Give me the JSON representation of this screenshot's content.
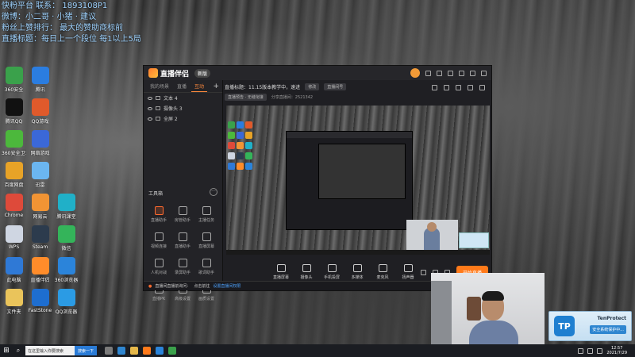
{
  "overlay_lines": [
    "快粉平台 联系： 1893108P1",
    "微博：小二哥 · 小猪 · 建议",
    "粉丝上赞排行：  最大的赞助商标前",
    "直播标题：每日上一个段位   每1以上5局"
  ],
  "desktop_icons": [
    {
      "label": "360安全",
      "icon": "shield-icon",
      "color": "#3aa14b"
    },
    {
      "label": "腾讯",
      "icon": "penguin-icon",
      "color": "#2b7de0"
    },
    {
      "label": "",
      "icon": "blank",
      "color": "transparent"
    },
    {
      "label": "腾讯QQ",
      "icon": "qq-icon",
      "color": "#111111"
    },
    {
      "label": "QQ游戏",
      "icon": "game-icon",
      "color": "#e05a2b"
    },
    {
      "label": "",
      "icon": "blank",
      "color": "transparent"
    },
    {
      "label": "360安全卫士",
      "icon": "plus-icon",
      "color": "#4cb83c"
    },
    {
      "label": "网络游戏",
      "icon": "controller-icon",
      "color": "#3b68d8"
    },
    {
      "label": "",
      "icon": "blank",
      "color": "transparent"
    },
    {
      "label": "百度网盘",
      "icon": "cloud-icon",
      "color": "#e8a327"
    },
    {
      "label": "迅雷",
      "icon": "bolt-icon",
      "color": "#6bb6f0"
    },
    {
      "label": "",
      "icon": "blank",
      "color": "transparent"
    },
    {
      "label": "Chrome",
      "icon": "browser-icon",
      "color": "#de4a3a"
    },
    {
      "label": "网易云",
      "icon": "music-icon",
      "color": "#f19434"
    },
    {
      "label": "腾讯课堂",
      "icon": "app-icon",
      "color": "#20b0c8"
    },
    {
      "label": "WPS",
      "icon": "doc-icon",
      "color": "#cfd6e2"
    },
    {
      "label": "Steam",
      "icon": "steam-icon",
      "color": "#2c3b4d"
    },
    {
      "label": "微信",
      "icon": "chat-icon",
      "color": "#34b45a"
    },
    {
      "label": "此电脑",
      "icon": "computer-icon",
      "color": "#2f79d6"
    },
    {
      "label": "直播伴侣",
      "icon": "live-icon",
      "color": "#ff8c2a"
    },
    {
      "label": "360浏览器",
      "icon": "browser2-icon",
      "color": "#2b84da"
    },
    {
      "label": "文件夹",
      "icon": "folder-icon",
      "color": "#eac45b"
    },
    {
      "label": "FastStone",
      "icon": "tool-icon",
      "color": "#1e6ed0"
    },
    {
      "label": "QQ浏览器",
      "icon": "browser3-icon",
      "color": "#2b9be4"
    }
  ],
  "app": {
    "name": "直播伴侣",
    "badge": "新版",
    "tabs": [
      "我的场景",
      "直播",
      "互动"
    ],
    "active_tab": 2,
    "scenes": [
      "文本 4",
      "摄像头 3",
      "全屏 2"
    ],
    "tools_title": "工具箱",
    "tools_more": "···",
    "tools": [
      {
        "label": "直播助手",
        "hot": true
      },
      {
        "label": "房管助手",
        "hot": false
      },
      {
        "label": "主播任务",
        "hot": false
      },
      {
        "label": "视频连接",
        "hot": false
      },
      {
        "label": "直播助手",
        "hot": false
      },
      {
        "label": "直播屏幕",
        "hot": false
      },
      {
        "label": "人机对战",
        "hot": false
      },
      {
        "label": "录屏助手",
        "hot": false
      },
      {
        "label": "歌词助手",
        "hot": false
      },
      {
        "label": "直播PK",
        "hot": false
      },
      {
        "label": "高级设置",
        "hot": false
      },
      {
        "label": "画质设置",
        "hot": false
      }
    ],
    "title_line": "直播标题：11.15版本教学中，速进",
    "title_chip": "修改",
    "title_chip2": "直播间号",
    "line2_chip": "直播预告 · 无缝衔接",
    "line2_text": "分享直播间：2521342",
    "bottom_items": [
      "直播屏幕",
      "摄像头",
      "手机投屏",
      "多媒体",
      "麦克风",
      "扬声器"
    ],
    "go_live": "开始直播",
    "notice_warn": "直播间直播前询问：",
    "notice_text": "点击前往",
    "notice_link": "设置直播间权限"
  },
  "tenprotect": {
    "logo": "TP",
    "title": "TenProtect",
    "status": "安全系统保护中..."
  },
  "taskbar": {
    "start_icon": "⊞",
    "search_placeholder": "在这里输入你要搜索",
    "search_button": "搜索一下",
    "time": "12:57",
    "date": "2021/7/29"
  }
}
